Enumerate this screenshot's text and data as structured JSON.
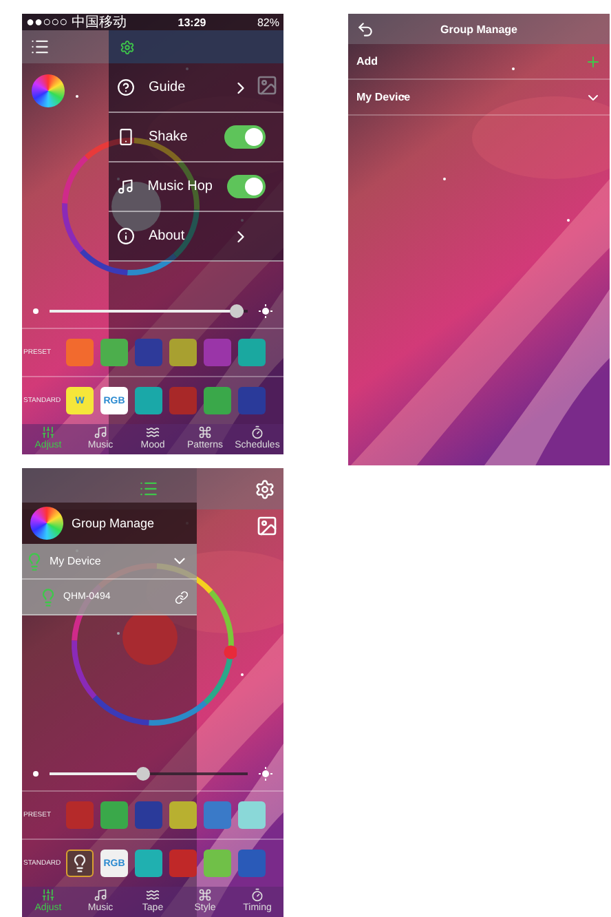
{
  "screens": [
    {
      "kind": "control",
      "status_bar": {
        "carrier": "●●○○○ 中国移动",
        "time": "13:29",
        "battery": "82%"
      },
      "menu": [
        {
          "kind": "link",
          "label": "Guide"
        },
        {
          "kind": "toggle",
          "label": "Shake",
          "on": true
        },
        {
          "kind": "toggle",
          "label": "Music Hop",
          "on": true
        },
        {
          "kind": "link",
          "label": "About"
        }
      ],
      "slider": {
        "level": 0.98
      },
      "preset": {
        "label": "PRESET",
        "swatches": [
          {
            "kind": "color",
            "color": "#f26a2e"
          },
          {
            "kind": "color",
            "color": "#4cae4c"
          },
          {
            "kind": "color",
            "color": "#2e3a9a"
          },
          {
            "kind": "color",
            "color": "#a8a030"
          },
          {
            "kind": "color",
            "color": "#9a35a8"
          },
          {
            "kind": "color",
            "color": "#1aa8a0"
          }
        ]
      },
      "standard": {
        "label": "STANDARD",
        "swatches": [
          {
            "kind": "text",
            "label": "W",
            "color": "#f5e63a"
          },
          {
            "kind": "text",
            "label": "RGB",
            "color": "#ffffff"
          },
          {
            "kind": "color",
            "color": "#1aa8a8"
          },
          {
            "kind": "color",
            "color": "#a82828"
          },
          {
            "kind": "color",
            "color": "#3aa84a"
          },
          {
            "kind": "color",
            "color": "#2a3a9a"
          }
        ]
      },
      "tabs": [
        {
          "label": "Adjust",
          "selected": true
        },
        {
          "label": "Music",
          "selected": false
        },
        {
          "label": "Mood",
          "selected": false
        },
        {
          "label": "Patterns",
          "selected": false
        },
        {
          "label": "Schedules",
          "selected": false
        }
      ]
    },
    {
      "kind": "groups",
      "title": "Group Manage",
      "rows": [
        {
          "kind": "add",
          "label": "Add"
        },
        {
          "kind": "expand",
          "label": "My Device"
        }
      ]
    },
    {
      "kind": "control",
      "drawer": {
        "title": "Group Manage",
        "items": [
          {
            "kind": "group",
            "label": "My Device"
          },
          {
            "kind": "device",
            "label": "QHM-0494"
          }
        ]
      },
      "slider": {
        "level": 0.47
      },
      "preset": {
        "label": "PRESET",
        "swatches": [
          {
            "kind": "color",
            "color": "#b52a2a"
          },
          {
            "kind": "color",
            "color": "#3aa84a"
          },
          {
            "kind": "color",
            "color": "#2a3a9a"
          },
          {
            "kind": "color",
            "color": "#b8b030"
          },
          {
            "kind": "color",
            "color": "#3a7ac8"
          },
          {
            "kind": "color",
            "color": "#8ad8d8"
          }
        ]
      },
      "standard": {
        "label": "STANDARD",
        "swatches": [
          {
            "kind": "bulb",
            "color": "#5a3a3a"
          },
          {
            "kind": "text",
            "label": "RGB",
            "color": "#f0f0f0"
          },
          {
            "kind": "color",
            "color": "#20b0b0"
          },
          {
            "kind": "color",
            "color": "#c02828"
          },
          {
            "kind": "color",
            "color": "#70c048"
          },
          {
            "kind": "color",
            "color": "#2a5ab8"
          }
        ]
      },
      "tabs": [
        {
          "label": "Adjust",
          "selected": true
        },
        {
          "label": "Music",
          "selected": false
        },
        {
          "label": "Tape",
          "selected": false
        },
        {
          "label": "Style",
          "selected": false
        },
        {
          "label": "Timing",
          "selected": false
        }
      ]
    }
  ]
}
